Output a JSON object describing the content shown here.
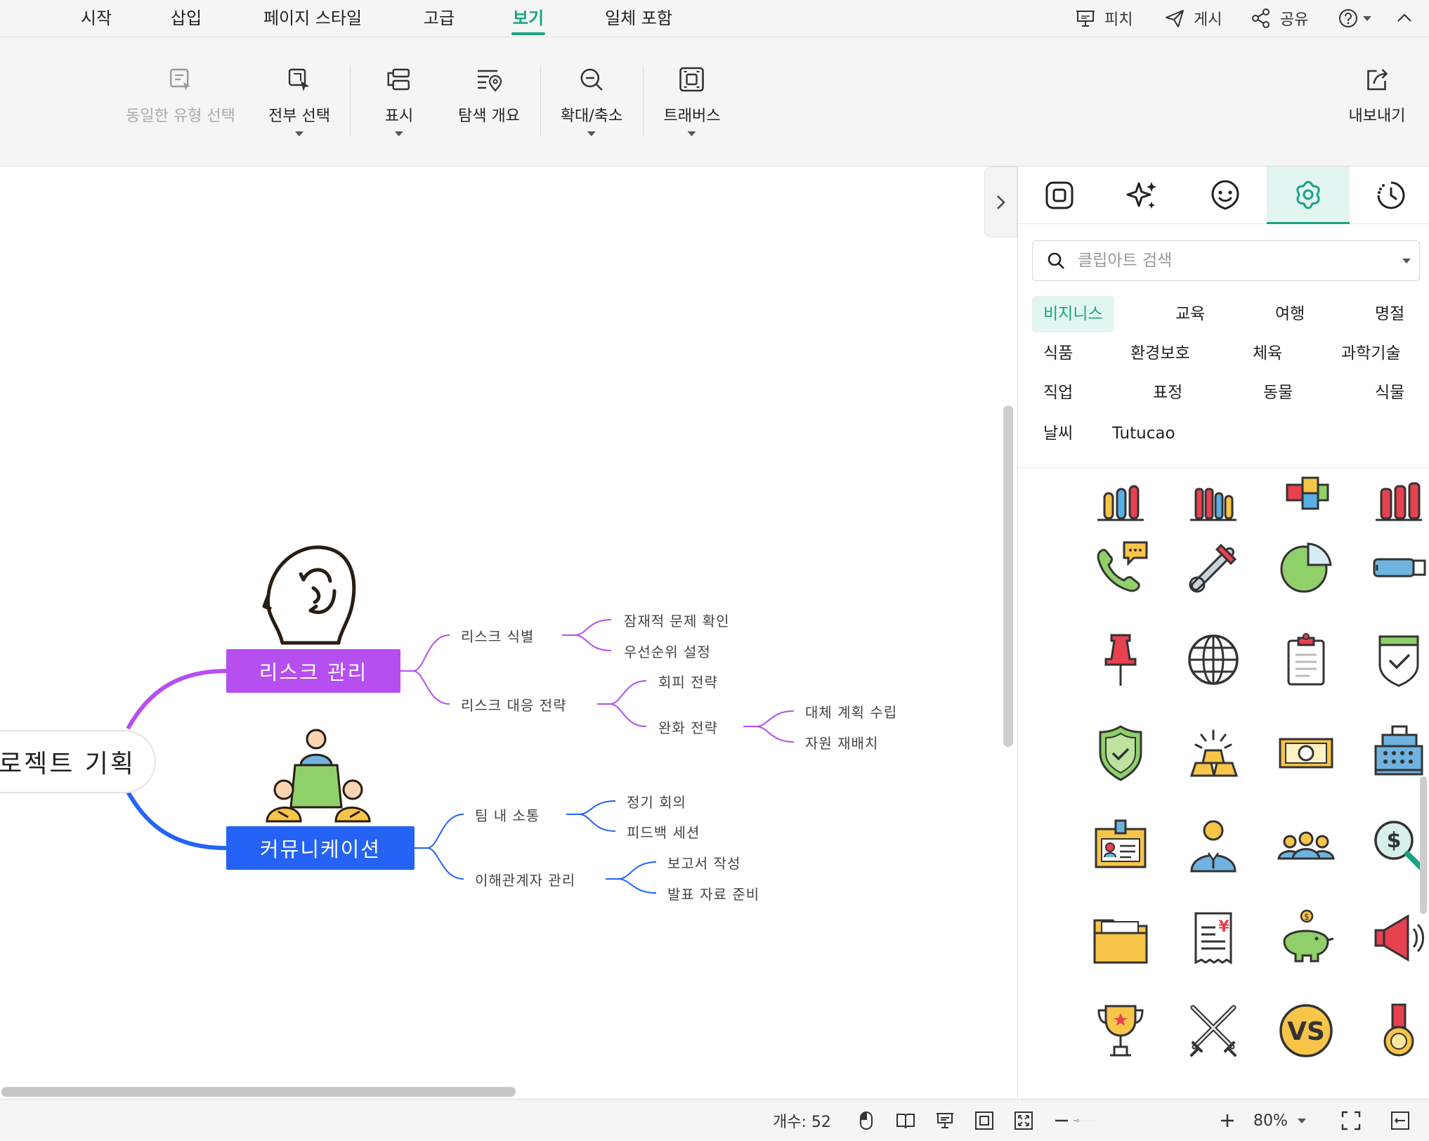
{
  "menu": {
    "tabs": [
      "시작",
      "삽입",
      "페이지 스타일",
      "고급",
      "보기",
      "일체 포함"
    ],
    "active_tab": "보기",
    "actions": {
      "pitch": "피치",
      "publish": "게시",
      "share": "공유"
    }
  },
  "ribbon": {
    "select_same": "동일한 유형 선택",
    "select_all": "전부 선택",
    "display": "표시",
    "navigator": "탐색 개요",
    "zoom": "확대/축소",
    "traverse": "트래버스",
    "export": "내보내기"
  },
  "mindmap": {
    "root": "로젝트 기획",
    "branch1": {
      "title": "리스크 관리",
      "color": "#b64ef0",
      "sub1": {
        "title": "리스크 식별",
        "leaves": [
          "잠재적 문제 확인",
          "우선순위 설정"
        ]
      },
      "sub2": {
        "title": "리스크 대응 전략",
        "leaf1": "회피 전략",
        "leaf2": {
          "title": "완화 전략",
          "leaves": [
            "대체 계획 수립",
            "자원 재배치"
          ]
        }
      }
    },
    "branch2": {
      "title": "커뮤니케이션",
      "color": "#2463f5",
      "sub1": {
        "title": "팀 내 소통",
        "leaves": [
          "정기 회의",
          "피드백 세션"
        ]
      },
      "sub2": {
        "title": "이해관계자 관리",
        "leaves": [
          "보고서 작성",
          "발표 자료 준비"
        ]
      }
    }
  },
  "panel": {
    "tabs": [
      "frame-icon",
      "sparkle-icon",
      "sticker-icon",
      "clipart-icon",
      "history-icon"
    ],
    "active_tab": "clipart-icon",
    "search_placeholder": "클립아트 검색",
    "categories": [
      "비지니스",
      "교육",
      "여행",
      "명절",
      "식품",
      "환경보호",
      "체육",
      "과학기술",
      "직업",
      "표정",
      "동물",
      "식물",
      "날씨",
      "Tutucao"
    ],
    "active_category": "비지니스",
    "accent": "#1aa383"
  },
  "status": {
    "count": "개수: 52",
    "zoom": "80%"
  }
}
